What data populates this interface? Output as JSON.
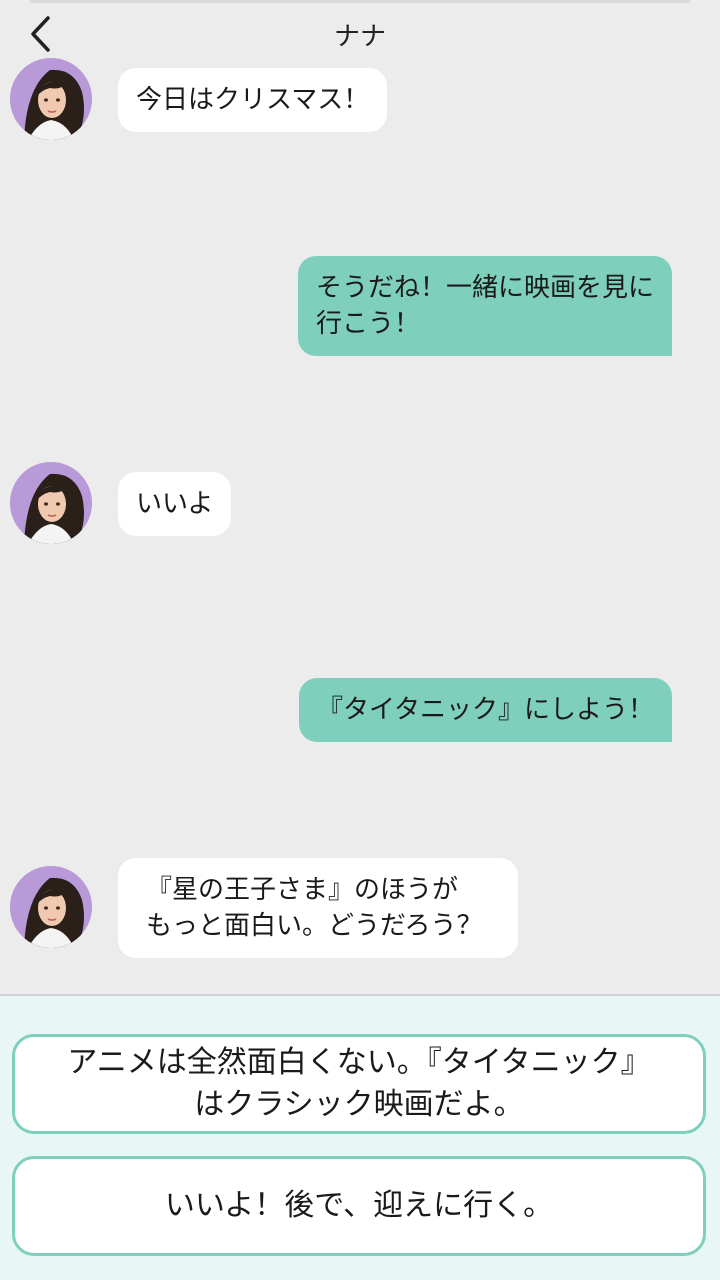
{
  "header": {
    "title": "ナナ",
    "back_icon": "chevron-left-icon"
  },
  "messages": [
    {
      "sender": "contact",
      "text": "今日はクリスマス！"
    },
    {
      "sender": "me",
      "text": "そうだね！一緒に映画を見に\n行こう！"
    },
    {
      "sender": "contact",
      "text": "いいよ"
    },
    {
      "sender": "me",
      "text": "『タイタニック』にしよう！"
    },
    {
      "sender": "contact",
      "text": "『星の王子さま』のほうが\nもっと面白い。どうだろう？"
    }
  ],
  "reply_options": [
    "アニメは全然面白くない。『タイタニック』\nはクラシック映画だよ。",
    "いいよ！後で、迎えに行く。"
  ],
  "colors": {
    "background": "#ececec",
    "incoming_bubble": "#ffffff",
    "outgoing_bubble": "#7ecfbb",
    "reply_panel": "#e8f7f6",
    "choice_border": "#7ecfbb",
    "avatar_bg": "#b89ad8"
  }
}
